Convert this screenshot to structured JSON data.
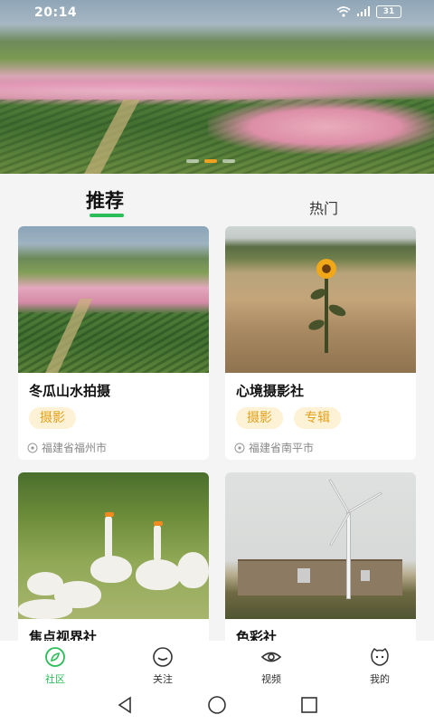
{
  "status": {
    "time": "20:14",
    "battery": "31"
  },
  "banner": {
    "slides": 4,
    "active_slide": 2
  },
  "tabs": [
    {
      "label": "推荐",
      "active": true
    },
    {
      "label": "热门",
      "active": false
    }
  ],
  "cards": [
    {
      "title": "冬瓜山水拍摄",
      "tags": [
        "摄影"
      ],
      "location": "福建省福州市"
    },
    {
      "title": "心境摄影社",
      "tags": [
        "摄影",
        "专辑"
      ],
      "location": "福建省南平市"
    },
    {
      "title": "焦点视界社"
    },
    {
      "title": "色彩社"
    }
  ],
  "bottom_nav": [
    {
      "label": "社区",
      "icon": "compass-icon",
      "active": true
    },
    {
      "label": "关注",
      "icon": "smile-icon",
      "active": false
    },
    {
      "label": "视频",
      "icon": "eye-icon",
      "active": false
    },
    {
      "label": "我的",
      "icon": "face-icon",
      "active": false
    }
  ],
  "colors": {
    "accent": "#2bbd57",
    "tag_bg": "#fdf1d6",
    "tag_text": "#e2a21b",
    "banner_active_dot": "#f2a020"
  }
}
